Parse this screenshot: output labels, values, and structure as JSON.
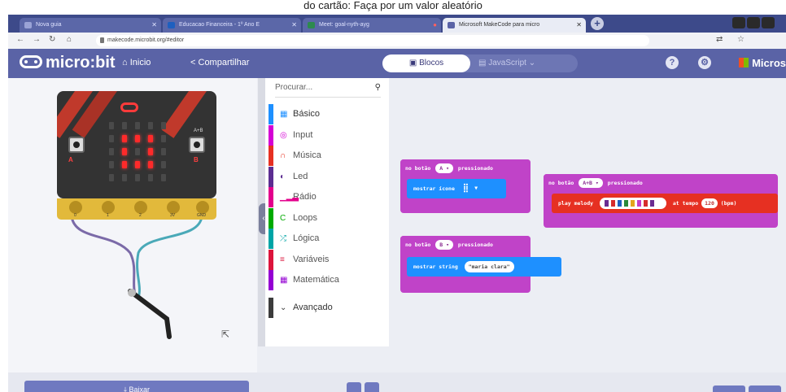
{
  "caption": "do cartão: Faça por um valor aleatório",
  "browser": {
    "tabs": [
      {
        "title": "Nova guia",
        "active": false
      },
      {
        "title": "Educacao Financeira - 1º Ano E",
        "active": false
      },
      {
        "title": "Meet: goal-nyth-ayg",
        "active": false
      },
      {
        "title": "Microsoft MakeCode para micro",
        "active": true
      }
    ],
    "url": "makecode.microbit.org/#editor"
  },
  "app": {
    "logo": "micro:bit",
    "home": "Inicio",
    "share": "Compartilhar",
    "blocks": "Blocos",
    "javascript": "JavaScript",
    "microsoft": "Micros"
  },
  "toolbox": {
    "search_placeholder": "Procurar...",
    "categories": [
      {
        "label": "Básico",
        "color": "#1e90ff",
        "icon": "grid-icon"
      },
      {
        "label": "Input",
        "color": "#d400d4",
        "icon": "target-icon"
      },
      {
        "label": "Música",
        "color": "#e63022",
        "icon": "headphones-icon"
      },
      {
        "label": "Led",
        "color": "#5c2d91",
        "icon": "toggle-icon"
      },
      {
        "label": "Rádio",
        "color": "#e3008c",
        "icon": "signal-icon"
      },
      {
        "label": "Loops",
        "color": "#00aa00",
        "icon": "loop-icon"
      },
      {
        "label": "Lógica",
        "color": "#00a4a6",
        "icon": "shuffle-icon"
      },
      {
        "label": "Variáveis",
        "color": "#dc143c",
        "icon": "lines-icon"
      },
      {
        "label": "Matemática",
        "color": "#9400d3",
        "icon": "calculator-icon"
      },
      {
        "label": "Avançado",
        "color": "#3c3c3c",
        "icon": "chevron-down-icon"
      }
    ]
  },
  "blocks": {
    "event_a": {
      "prefix": "no botão",
      "button": "A",
      "suffix": "pressionado",
      "statement": "mostrar ícone"
    },
    "event_ab": {
      "prefix": "no botão",
      "button": "A+B",
      "suffix": "pressionado",
      "statement": "play melody",
      "tempo_label": "at tempo",
      "tempo": "120",
      "unit": "(bpm)"
    },
    "event_b": {
      "prefix": "no botão",
      "button": "B",
      "suffix": "pressionado",
      "statement": "mostrar string",
      "text": "\"maria clara\""
    }
  },
  "simulator": {
    "button_a": "A",
    "button_b": "B",
    "label_ab": "A+B",
    "pins": [
      "0",
      "1",
      "2",
      "3V",
      "GND"
    ],
    "led_matrix": [
      [
        0,
        0,
        0,
        0,
        0
      ],
      [
        0,
        1,
        1,
        1,
        0
      ],
      [
        0,
        1,
        0,
        1,
        0
      ],
      [
        0,
        1,
        1,
        1,
        0
      ],
      [
        0,
        0,
        0,
        0,
        0
      ]
    ]
  },
  "footer": {
    "save": "Baixar"
  },
  "colors": {
    "app_header": "#5a63a6",
    "event_block": "#c043c8",
    "basic_block": "#1e90ff",
    "music_block": "#e63022"
  }
}
